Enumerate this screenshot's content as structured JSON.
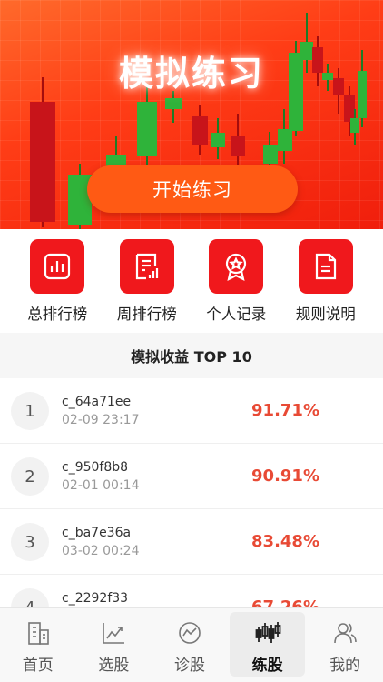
{
  "banner": {
    "title": "模拟练习",
    "start_label": "开始练习"
  },
  "menu": [
    {
      "label": "总排行榜",
      "icon": "bar-chart-icon"
    },
    {
      "label": "周排行榜",
      "icon": "document-chart-icon"
    },
    {
      "label": "个人记录",
      "icon": "award-badge-icon"
    },
    {
      "label": "规则说明",
      "icon": "document-icon"
    }
  ],
  "section_title": "模拟收益 TOP 10",
  "rankings": [
    {
      "rank": "1",
      "user": "c_64a71ee",
      "time": "02-09 23:17",
      "percent": "91.71%"
    },
    {
      "rank": "2",
      "user": "c_950f8b8",
      "time": "02-01 00:14",
      "percent": "90.91%"
    },
    {
      "rank": "3",
      "user": "c_ba7e36a",
      "time": "03-02 00:24",
      "percent": "83.48%"
    },
    {
      "rank": "4",
      "user": "c_2292f33",
      "time": "",
      "percent": "67.26%"
    }
  ],
  "tabs": [
    {
      "label": "首页",
      "icon": "building-icon"
    },
    {
      "label": "选股",
      "icon": "line-chart-icon"
    },
    {
      "label": "诊股",
      "icon": "diagnosis-icon"
    },
    {
      "label": "练股",
      "icon": "candlestick-icon"
    },
    {
      "label": "我的",
      "icon": "user-icon"
    }
  ],
  "active_tab": "练股",
  "colors": {
    "brand_red": "#f0181c",
    "banner_orange": "#ff5a14",
    "positive_text": "#e84a35",
    "candle_green": "#2fb33a",
    "candle_red": "#d51616"
  }
}
